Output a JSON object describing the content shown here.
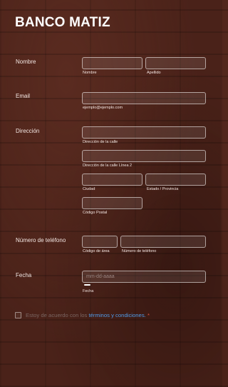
{
  "form": {
    "title": "BANCO MATIZ",
    "name": {
      "label": "Nombre",
      "first_sub": "Nombre",
      "last_sub": "Apellido"
    },
    "email": {
      "label": "Email",
      "sub": "ejemplo@ejemplo.com"
    },
    "address": {
      "label": "Dirección",
      "street_sub": "Dirección de la calle",
      "street2_sub": "Dirección de la calle Línea 2",
      "city_sub": "Ciudad",
      "state_sub": "Estado / Provincia",
      "zip_sub": "Código Postal"
    },
    "phone": {
      "label": "Número de teléfono",
      "area_sub": "Código de área",
      "number_sub": "Número de teléfono"
    },
    "date": {
      "label": "Fecha",
      "placeholder": "mm-dd-aaaa",
      "sub": "Fecha"
    },
    "consent": {
      "text": "Estoy de acuerdo con los ",
      "link": "términos y condiciones.",
      "required_mark": "*"
    }
  },
  "colors": {
    "background": "#4a2219",
    "link": "#4f9be8",
    "required": "#e0533f"
  }
}
